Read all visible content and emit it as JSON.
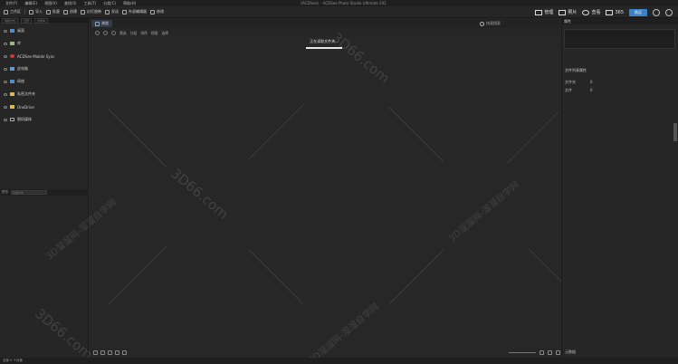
{
  "menubar": {
    "items": [
      "文件(F)",
      "编辑(E)",
      "视图(V)",
      "查找(S)",
      "工具(T)",
      "分类(C)",
      "帮助(H)"
    ]
  },
  "window": {
    "title": "《ACDSee》- ACDSee Photo Studio Ultimate 202"
  },
  "toolbar": {
    "items": [
      "工作区",
      "导入",
      "批量",
      "创建",
      "幻灯放映",
      "发送",
      "外部编辑器",
      "修改"
    ],
    "modes": [
      "管理",
      "照片",
      "查看",
      "365"
    ],
    "buy_label": "购买"
  },
  "left_panel": {
    "tabs": [
      "快捷方式",
      "日历",
      "文件夹"
    ],
    "tree": [
      {
        "label": "桌面"
      },
      {
        "label": "库"
      },
      {
        "label": "ACDSee Mobile Sync"
      },
      {
        "label": "此电脑"
      },
      {
        "label": "网络"
      },
      {
        "label": "私密文件夹"
      },
      {
        "label": "OneDrive"
      },
      {
        "label": "脱机媒体"
      }
    ],
    "lower_label": "预览",
    "lower_input": "隐藏文件"
  },
  "main": {
    "tab_label": "浏览",
    "search_label": "快速搜索",
    "path": [
      "筛选",
      "分组",
      "排序",
      "视图",
      "选择"
    ],
    "popup_text": "正在读取文件夹..."
  },
  "right_panel": {
    "header": "属性",
    "section": "文件列表属性",
    "rows": [
      {
        "label": "文件夹",
        "value": "0"
      },
      {
        "label": "文件",
        "value": "0"
      }
    ],
    "footer": "元数据"
  },
  "watermark": {
    "text": "3D66.com",
    "secondary": "3D溜溜网-溜溜自学网"
  },
  "statusbar": {
    "text": "全部 0 个对象"
  }
}
